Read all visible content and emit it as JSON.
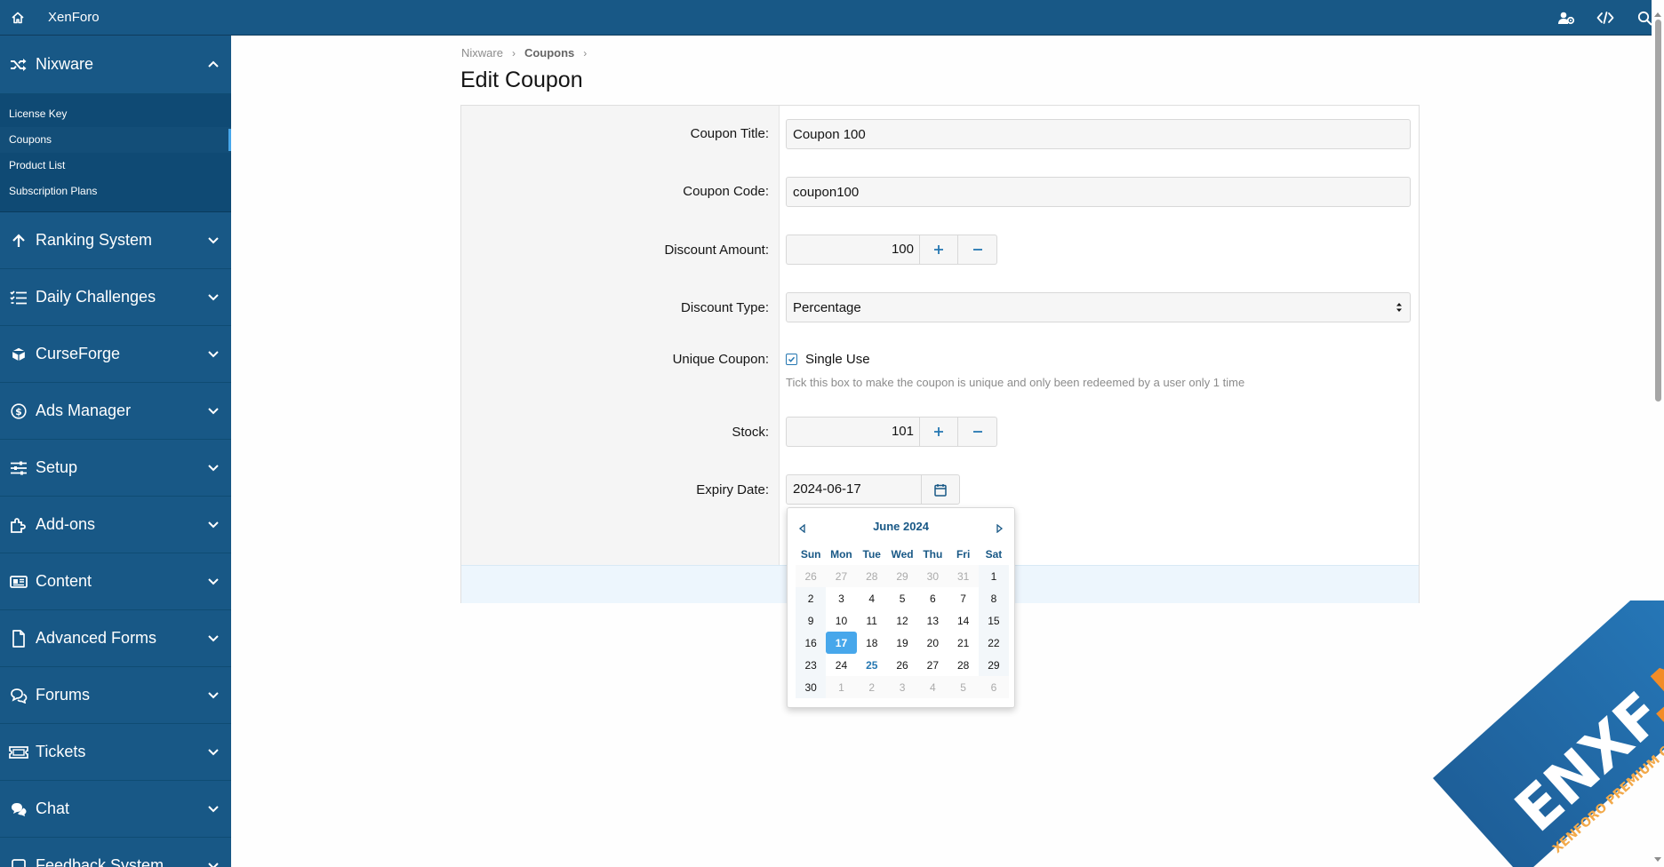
{
  "topbar": {
    "brand": "XenForo"
  },
  "sidebar": {
    "expanded": {
      "label": "Nixware",
      "items": [
        {
          "label": "License Key",
          "active": false
        },
        {
          "label": "Coupons",
          "active": true
        },
        {
          "label": "Product List",
          "active": false
        },
        {
          "label": "Subscription Plans",
          "active": false
        }
      ]
    },
    "sections": [
      {
        "label": "Ranking System",
        "icon": "arrow-up-icon"
      },
      {
        "label": "Daily Challenges",
        "icon": "list-check-icon"
      },
      {
        "label": "CurseForge",
        "icon": "cube-icon"
      },
      {
        "label": "Ads Manager",
        "icon": "dollar-circle-icon"
      },
      {
        "label": "Setup",
        "icon": "sliders-icon"
      },
      {
        "label": "Add-ons",
        "icon": "puzzle-icon"
      },
      {
        "label": "Content",
        "icon": "newspaper-icon"
      },
      {
        "label": "Advanced Forms",
        "icon": "file-icon"
      },
      {
        "label": "Forums",
        "icon": "comments-icon"
      },
      {
        "label": "Tickets",
        "icon": "ticket-icon"
      },
      {
        "label": "Chat",
        "icon": "chat-icon"
      },
      {
        "label": "Feedback System",
        "icon": "feedback-icon"
      }
    ]
  },
  "breadcrumb": [
    "Nixware",
    "Coupons"
  ],
  "page": {
    "title": "Edit Coupon"
  },
  "form": {
    "coupon_title": {
      "label": "Coupon Title:",
      "value": "Coupon 100"
    },
    "coupon_code": {
      "label": "Coupon Code:",
      "value": "coupon100"
    },
    "discount_amount": {
      "label": "Discount Amount:",
      "value": "100"
    },
    "discount_type": {
      "label": "Discount Type:",
      "value": "Percentage"
    },
    "unique_coupon": {
      "label": "Unique Coupon:",
      "checkbox_label": "Single Use",
      "checked": true,
      "hint": "Tick this box to make the coupon is unique and only been redeemed by a user only 1 time"
    },
    "stock": {
      "label": "Stock:",
      "value": "101"
    },
    "expiry_date": {
      "label": "Expiry Date:",
      "value": "2024-06-17"
    }
  },
  "calendar": {
    "month_label": "June 2024",
    "dow": [
      "Sun",
      "Mon",
      "Tue",
      "Wed",
      "Thu",
      "Fri",
      "Sat"
    ],
    "weeks": [
      [
        "26",
        "27",
        "28",
        "29",
        "30",
        "31",
        "1"
      ],
      [
        "2",
        "3",
        "4",
        "5",
        "6",
        "7",
        "8"
      ],
      [
        "9",
        "10",
        "11",
        "12",
        "13",
        "14",
        "15"
      ],
      [
        "16",
        "17",
        "18",
        "19",
        "20",
        "21",
        "22"
      ],
      [
        "23",
        "24",
        "25",
        "26",
        "27",
        "28",
        "29"
      ],
      [
        "30",
        "1",
        "2",
        "3",
        "4",
        "5",
        "6"
      ]
    ],
    "selected": "17",
    "today": "25"
  },
  "watermark": {
    "text_main": "ENXF",
    "text_dot": ".NET",
    "text_sub": "XENFORO PREMIUM COMMUNITY"
  },
  "colors": {
    "brand": "#185886",
    "accent": "#47a7eb",
    "link": "#2577b1"
  }
}
